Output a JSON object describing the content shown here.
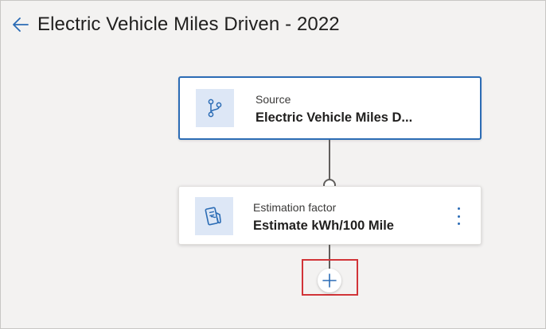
{
  "page": {
    "title": "Electric Vehicle Miles Driven - 2022",
    "back_icon": "arrow-left-icon"
  },
  "flow": {
    "source_card": {
      "label": "Source",
      "value": "Electric Vehicle Miles D...",
      "icon": "branch-icon"
    },
    "estimation_card": {
      "label": "Estimation factor",
      "value": "Estimate kWh/100 Mile",
      "icon": "fuel-pump-icon",
      "menu_icon": "more-vertical-icon"
    },
    "add_step": {
      "icon": "plus-icon"
    }
  },
  "colors": {
    "accent": "#2b6cb5",
    "highlight": "#d13438",
    "connector": "#605e5c",
    "icon_tile": "#dde7f6"
  }
}
